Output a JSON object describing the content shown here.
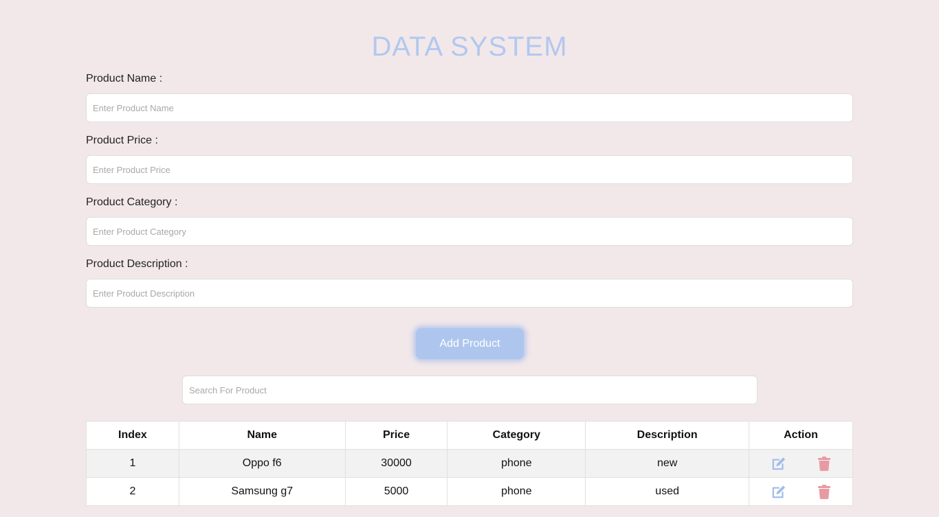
{
  "app": {
    "title": "DATA SYSTEM"
  },
  "form": {
    "name_label": "Product Name :",
    "name_placeholder": "Enter Product Name",
    "price_label": "Product Price :",
    "price_placeholder": "Enter Product Price",
    "category_label": "Product Category :",
    "category_placeholder": "Enter Product Category",
    "description_label": "Product Description :",
    "description_placeholder": "Enter Product Description",
    "add_button_label": "Add Product"
  },
  "search": {
    "placeholder": "Search For Product"
  },
  "table": {
    "headers": [
      "Index",
      "Name",
      "Price",
      "Category",
      "Description",
      "Action"
    ],
    "rows": [
      {
        "index": "1",
        "name": "Oppo f6",
        "price": "30000",
        "category": "phone",
        "description": "new"
      },
      {
        "index": "2",
        "name": "Samsung g7",
        "price": "5000",
        "category": "phone",
        "description": "used"
      }
    ]
  },
  "icons": {
    "edit": "edit-icon",
    "delete": "trash-icon"
  },
  "colors": {
    "background": "#f2e8ea",
    "accent": "#aec6ee",
    "title": "#b2c8ee",
    "edit_icon": "#9ebcea",
    "delete_icon": "#e89aa3"
  }
}
